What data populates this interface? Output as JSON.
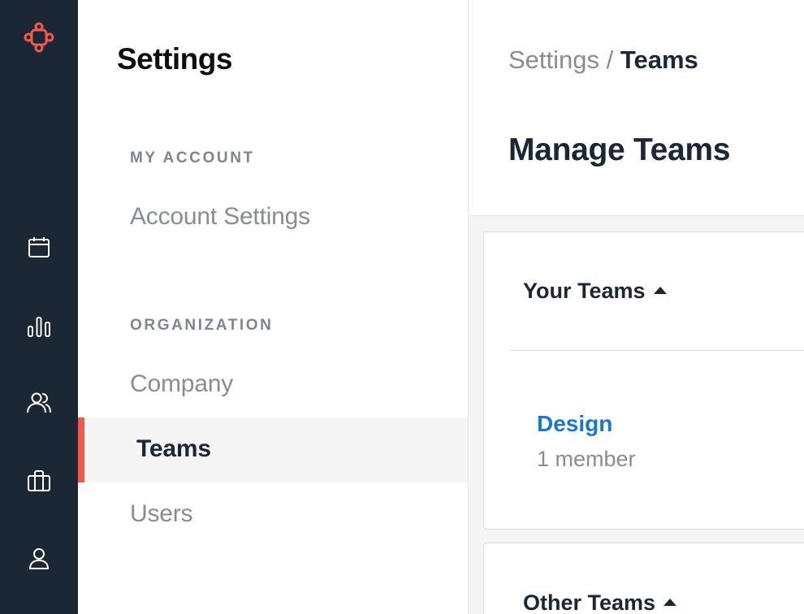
{
  "rail": {
    "logo_icon": "org-logo-icon",
    "items": [
      {
        "icon": "calendar-icon"
      },
      {
        "icon": "bar-chart-icon"
      },
      {
        "icon": "people-icon"
      },
      {
        "icon": "briefcase-icon"
      },
      {
        "icon": "user-icon"
      }
    ],
    "colors": {
      "background": "#1b2735",
      "accent": "#f2594a",
      "icon": "#ffffff"
    }
  },
  "nav": {
    "title": "Settings",
    "sections": [
      {
        "label": "MY ACCOUNT",
        "items": [
          {
            "label": "Account Settings"
          }
        ]
      },
      {
        "label": "ORGANIZATION",
        "items": [
          {
            "label": "Company"
          },
          {
            "label": "Teams",
            "active": true
          },
          {
            "label": "Users"
          }
        ]
      }
    ],
    "active_indicator_color": "#f2594a"
  },
  "main": {
    "breadcrumb": {
      "parent": "Settings",
      "separator": " / ",
      "current": "Teams"
    },
    "title": "Manage Teams",
    "your_teams": {
      "heading": "Your Teams",
      "teams": [
        {
          "name": "Design",
          "members": "1 member"
        }
      ]
    },
    "other_teams": {
      "heading": "Other Teams"
    }
  }
}
